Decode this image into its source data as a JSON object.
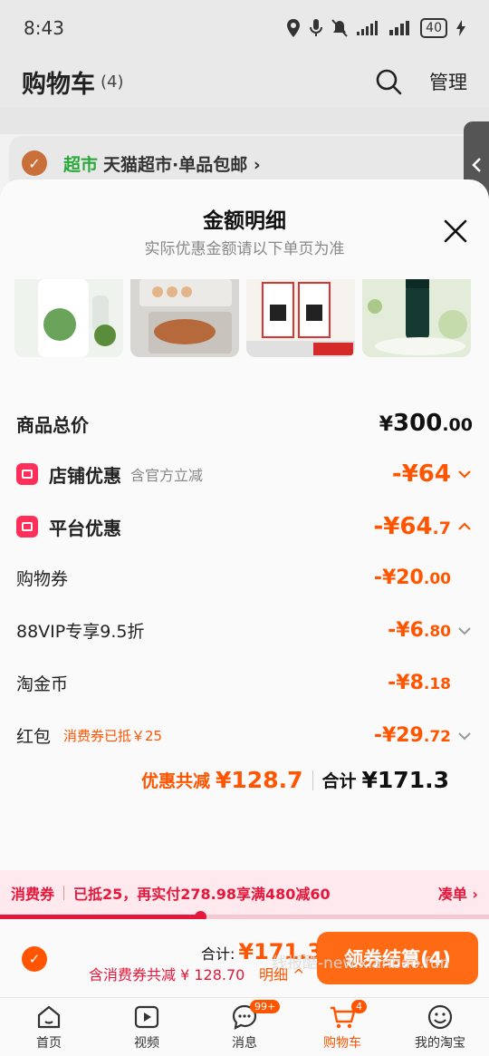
{
  "status": {
    "time": "8:43",
    "battery": "40"
  },
  "header": {
    "title": "购物车",
    "count": "(4)",
    "manage": "管理"
  },
  "background_store": {
    "tag": "超市",
    "name": "天猫超市·单品包邮 ›"
  },
  "sheet": {
    "title": "金额明细",
    "subtitle": "实际优惠金额请以下单页为准",
    "total_label": "商品总价",
    "total": {
      "yen": "¥",
      "int": "300",
      "dec": ".00"
    },
    "store_discount": {
      "label": "店铺优惠",
      "note": "含官方立减",
      "amount": "-¥64"
    },
    "platform_discount": {
      "label": "平台优惠",
      "int": "-¥64",
      "dec": ".7"
    },
    "items": [
      {
        "label": "购物券",
        "int": "-¥20",
        "dec": ".00",
        "tag": ""
      },
      {
        "label": "88VIP专享9.5折",
        "int": "-¥6",
        "dec": ".80",
        "tag": ""
      },
      {
        "label": "淘金币",
        "int": "-¥8",
        "dec": ".18",
        "tag": ""
      },
      {
        "label": "红包",
        "int": "-¥29",
        "dec": ".72",
        "tag": "消费券已抵￥25"
      }
    ],
    "summary": {
      "discount_label": "优惠共减",
      "discount_value": "¥128.7",
      "total_label": "合计",
      "total_value": "¥171.3"
    }
  },
  "voucher": {
    "tag": "消费券",
    "text": "已抵25，再实付278.98享满480减60",
    "link": "凑单 ›",
    "progress": 0.41
  },
  "checkout": {
    "total_label": "合计:",
    "total_value": "¥171.30",
    "discount_text": "含消费券共减 ¥ 128.70",
    "detail_link": "明细 ^",
    "button": "领券结算(4)",
    "watermark": "线报酷-new.xianbao.fun"
  },
  "tabs": [
    {
      "label": "首页",
      "icon": "home-icon",
      "badge": ""
    },
    {
      "label": "视频",
      "icon": "video-icon",
      "badge": ""
    },
    {
      "label": "消息",
      "icon": "message-icon",
      "badge": "99+"
    },
    {
      "label": "购物车",
      "icon": "cart-icon",
      "badge": "4"
    },
    {
      "label": "我的淘宝",
      "icon": "profile-icon",
      "badge": ""
    }
  ],
  "colors": {
    "accent": "#ff5400",
    "red": "#e5173b",
    "button": "#ff6a14"
  }
}
